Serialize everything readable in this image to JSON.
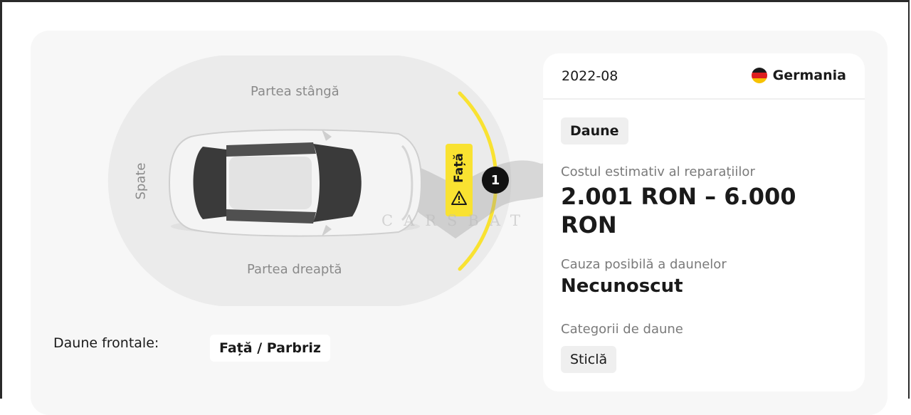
{
  "diagram": {
    "zone_left": "Partea stângă",
    "zone_right": "Partea dreaptă",
    "zone_back": "Spate",
    "front_tag": "Față",
    "marker_number": "1",
    "watermark": "CARSBAT",
    "highlight_color": "#f9e231"
  },
  "frontal": {
    "label": "Daune frontale:",
    "value": "Față / Parbriz"
  },
  "card": {
    "date": "2022-08",
    "country": "Germania",
    "type_chip": "Daune",
    "cost_label": "Costul estimativ al reparațiilor",
    "cost_value": "2.001 RON – 6.000 RON",
    "cause_label": "Cauza posibilă a daunelor",
    "cause_value": "Necunoscut",
    "categories_label": "Categorii de daune",
    "category_chip": "Sticlă"
  }
}
